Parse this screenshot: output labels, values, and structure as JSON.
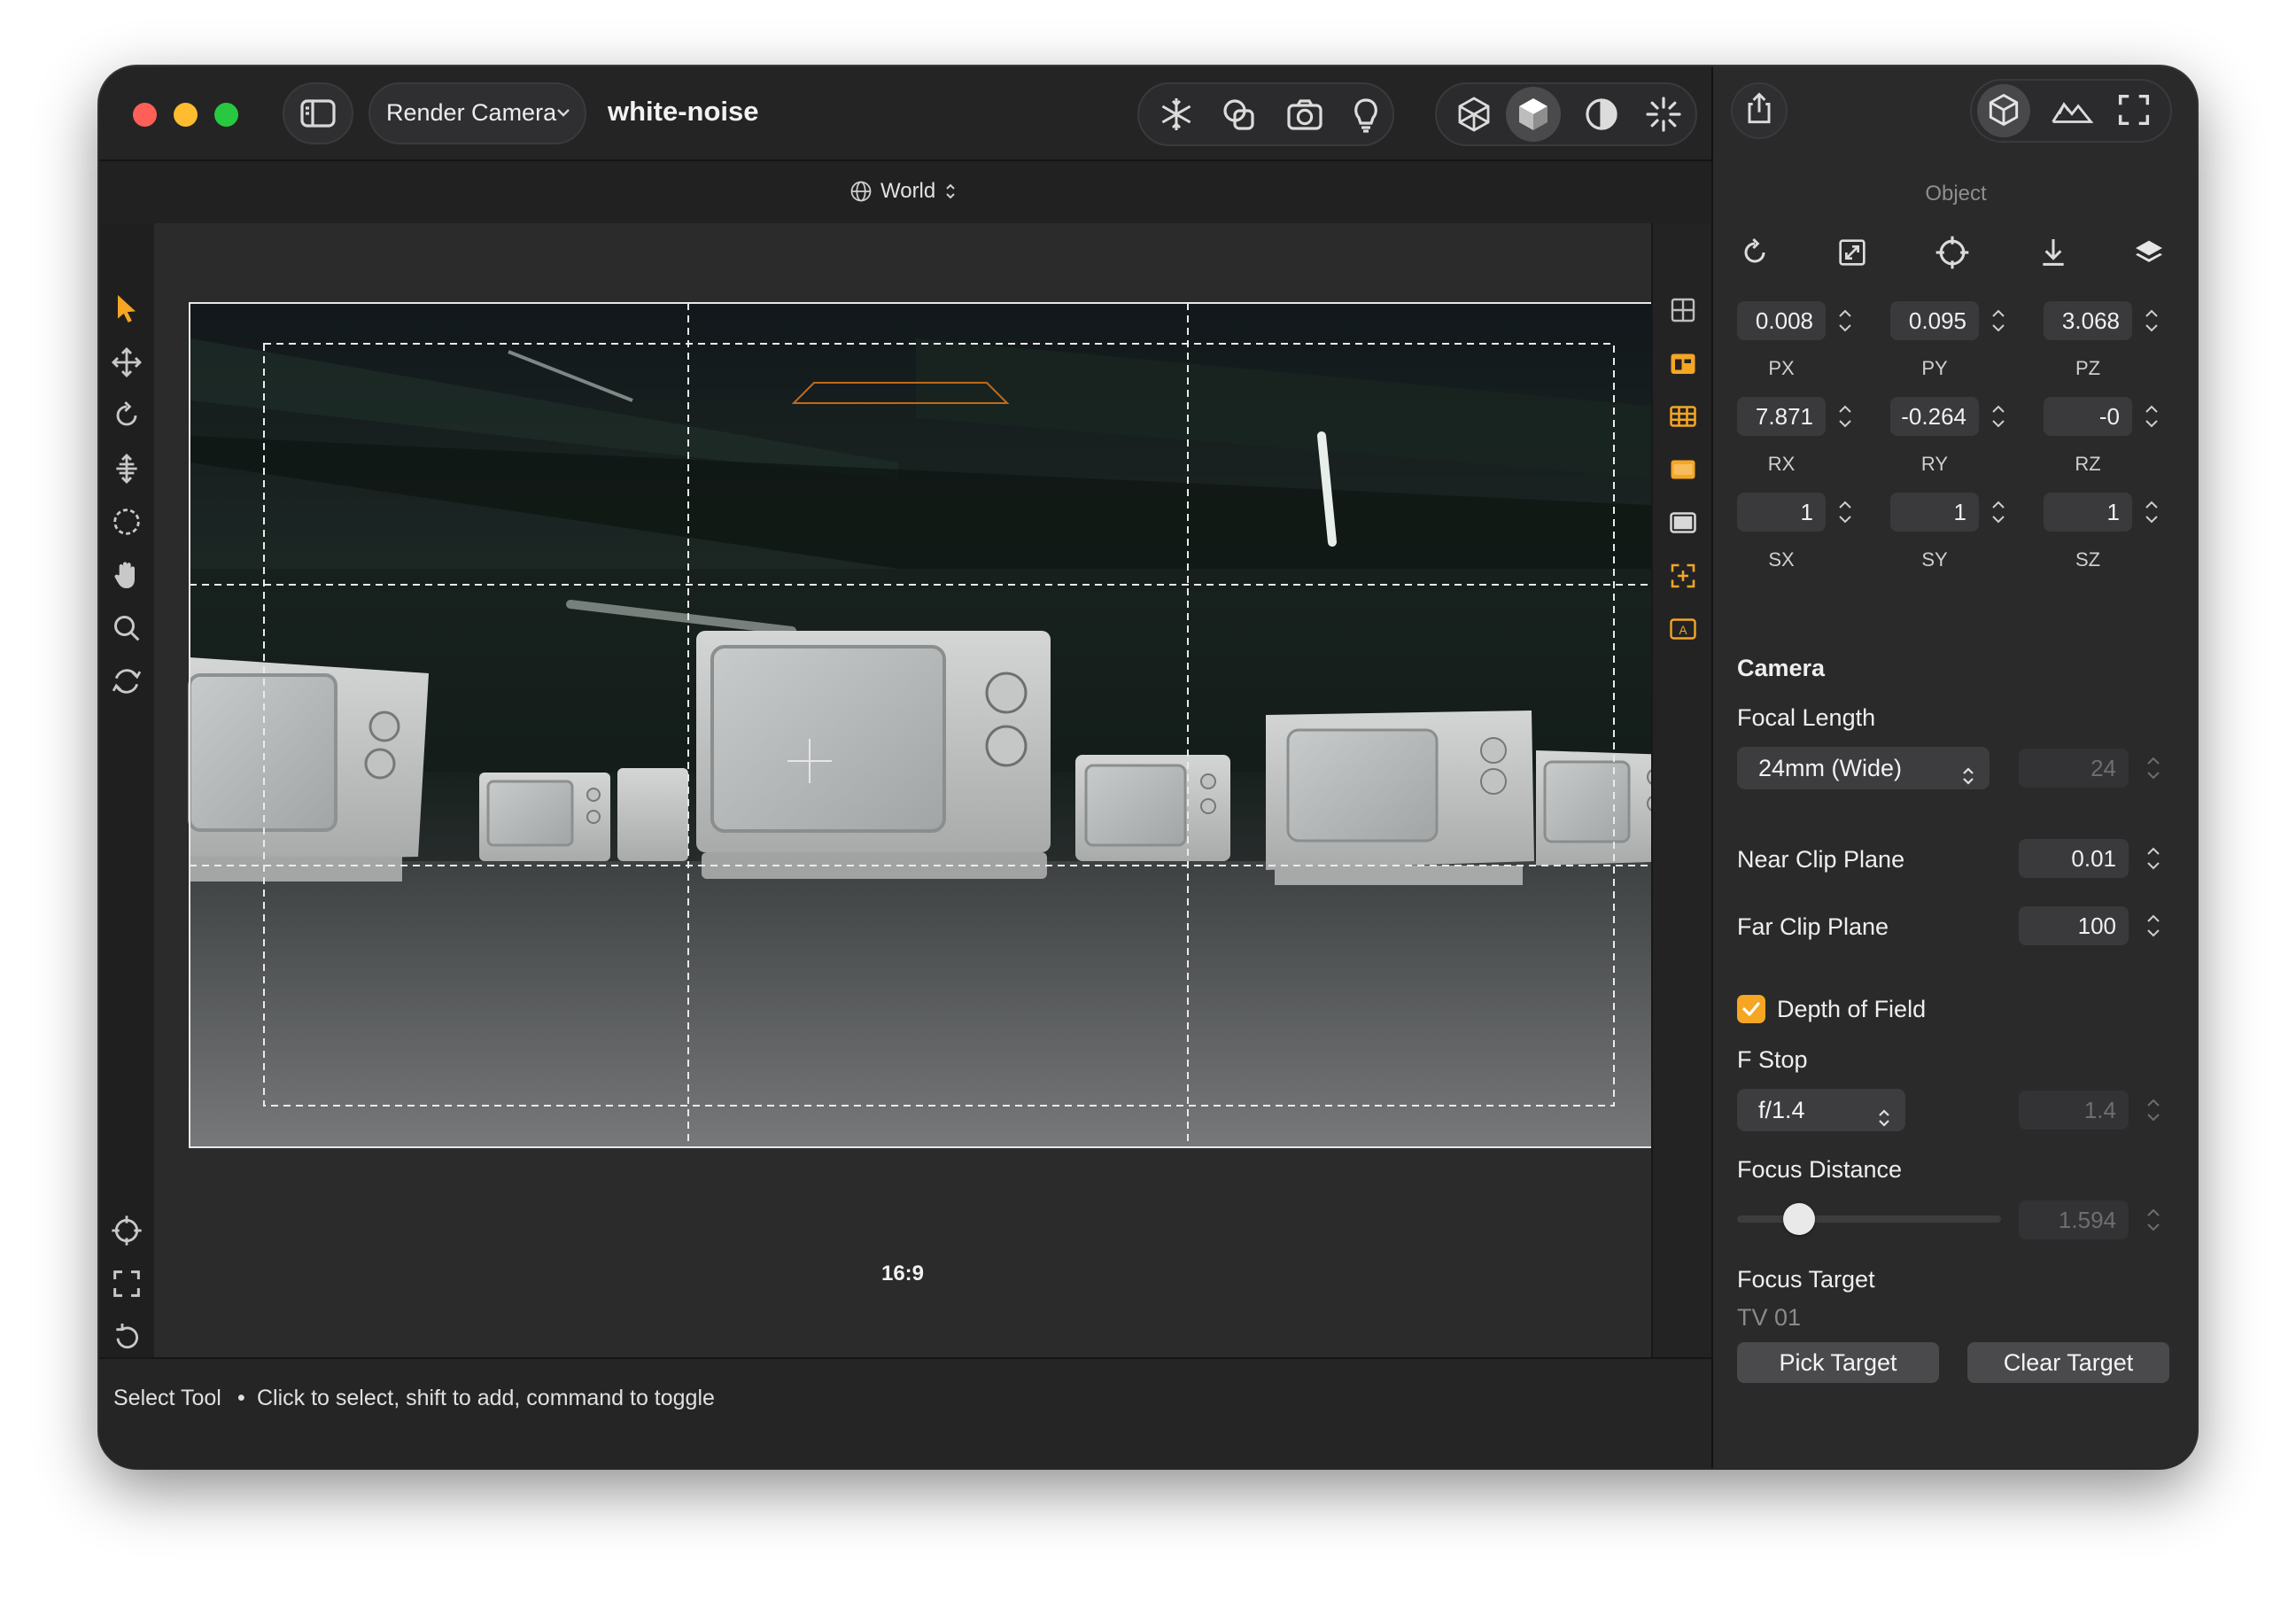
{
  "window": {
    "camera_selector": "Render Camera",
    "document_title": "white-noise"
  },
  "subbar": {
    "space_selector": "World"
  },
  "viewport": {
    "aspect_label": "16:9"
  },
  "status": {
    "tool": "Select Tool",
    "separator": "•",
    "hint": "Click to select, shift to add, command to toggle"
  },
  "inspector": {
    "section_title": "Object",
    "transform": {
      "px": "0.008",
      "py": "0.095",
      "pz": "3.068",
      "rx": "7.871",
      "ry": "-0.264",
      "rz": "-0",
      "sx": "1",
      "sy": "1",
      "sz": "1",
      "labels": {
        "px": "PX",
        "py": "PY",
        "pz": "PZ",
        "rx": "RX",
        "ry": "RY",
        "rz": "RZ",
        "sx": "SX",
        "sy": "SY",
        "sz": "SZ"
      }
    },
    "camera": {
      "heading": "Camera",
      "focal_length_label": "Focal Length",
      "focal_length_preset": "24mm (Wide)",
      "focal_length_value": "24",
      "near_clip_label": "Near Clip Plane",
      "near_clip_value": "0.01",
      "far_clip_label": "Far Clip Plane",
      "far_clip_value": "100",
      "dof_label": "Depth of Field",
      "dof_enabled": true,
      "fstop_label": "F Stop",
      "fstop_preset": "f/1.4",
      "fstop_value": "1.4",
      "focus_distance_label": "Focus Distance",
      "focus_distance_value": "1.594",
      "focus_distance_slider": 0.2,
      "focus_target_label": "Focus Target",
      "focus_target_value": "TV 01",
      "pick_target_button": "Pick Target",
      "clear_target_button": "Clear Target"
    }
  },
  "colors": {
    "accent": "#f5a623",
    "close": "#ff5f57",
    "minimize": "#febc2e",
    "zoom": "#28c840"
  },
  "icons": {
    "toolbar": [
      "sidebar-icon",
      "snowflake-icon",
      "shapes-icon",
      "camera-icon",
      "lightbulb-icon",
      "wireframe-cube-icon",
      "solid-cube-icon",
      "contrast-icon",
      "sparkle-icon",
      "share-icon",
      "cube-icon",
      "terrain-icon",
      "fullscreen-icon"
    ],
    "left_tools": [
      "pointer-icon",
      "move-icon",
      "rotate-icon",
      "scale-icon",
      "lasso-icon",
      "hand-icon",
      "zoom-icon",
      "orbit-icon",
      "crosshair-icon",
      "frame-icon",
      "reset-icon"
    ],
    "right_tools": [
      "grid-overlay-icon",
      "safe-frame-icon",
      "table-icon",
      "letterbox-icon",
      "screen-icon",
      "focus-icon",
      "label-icon"
    ]
  }
}
